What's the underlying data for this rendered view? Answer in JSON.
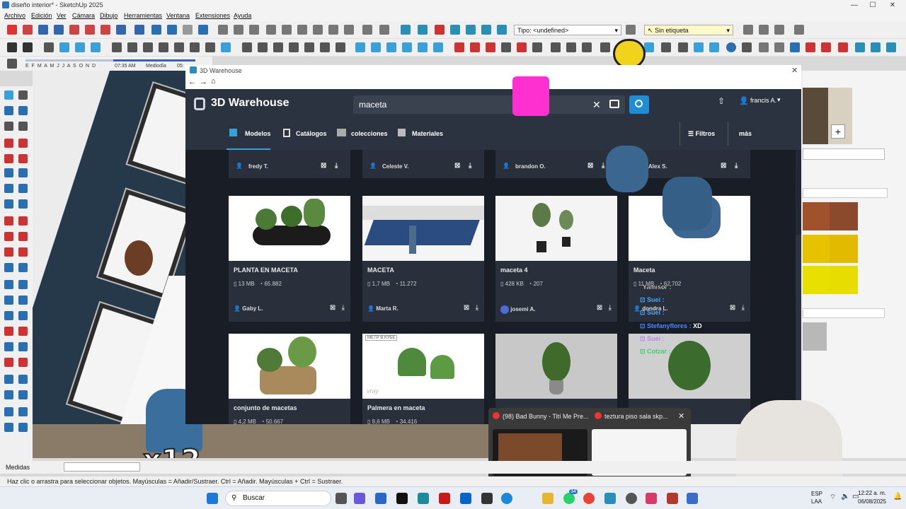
{
  "window": {
    "title": "diseño interior* - SketchUp 2025"
  },
  "menu": [
    "Archivo",
    "Edición",
    "Ver",
    "Cámara",
    "Dibujo",
    "Herramientas",
    "Ventana",
    "Extensiones",
    "Ayuda"
  ],
  "toolbar": {
    "type_dropdown": "Tipo: <undefined>",
    "tag_dropdown": "Sin etiqueta"
  },
  "sun": {
    "months": "E F M A M J J A S O N D",
    "time_start": "07:35 AM",
    "midday": "Mediodía",
    "time_end": "05:"
  },
  "warehouse": {
    "window_title": "3D Warehouse",
    "logo": "3D Warehouse",
    "search_value": "maceta",
    "user": "francis A.",
    "tabs": [
      "Modelos",
      "Catálogos",
      "colecciones",
      "Materiales"
    ],
    "filters": "Filtros",
    "more": "más",
    "top_users": [
      "fredy T.",
      "Celeste V.",
      "brandon O.",
      "Alex S."
    ],
    "row1": [
      {
        "name": "PLANTA EN MACETA",
        "size": "13 MB",
        "views": "65.882",
        "user": "Gaby L."
      },
      {
        "name": "MACETA",
        "size": "1,7 MB",
        "views": "11.272",
        "user": "Marta R."
      },
      {
        "name": "maceta 4",
        "size": "428 KB",
        "views": "207",
        "user": "josemi A."
      },
      {
        "name": "Maceta",
        "size": "11 MB",
        "views": "62.702",
        "user": "dondra L."
      }
    ],
    "row2": [
      {
        "name": "conjunto de macetas",
        "size": "4,2 MB",
        "views": "50.667"
      },
      {
        "name": "Palmera en maceta",
        "size": "8,6 MB",
        "views": "34.416"
      },
      {
        "name": "",
        "size": "",
        "views": ""
      },
      {
        "name": "",
        "size": "",
        "views": ""
      }
    ],
    "thumb_badge": "МЕТР В КУБЕ",
    "thumb_watermark": "vray"
  },
  "chat": [
    {
      "user": "Yamisor",
      "msg": ""
    },
    {
      "user": "Suei",
      "msg": ""
    },
    {
      "user": "Suei",
      "msg": ""
    },
    {
      "user": "Stefanyflores",
      "msg": "XD"
    },
    {
      "user": "Suei",
      "msg": ""
    },
    {
      "user": "Cotzar",
      "msg": ""
    }
  ],
  "overlay_multiplier": "x12",
  "popup": {
    "tab1": "(98) Bad Bunny - Tití Me Pre...",
    "tab2": "teztura piso sala skp..."
  },
  "measures_label": "Medidas",
  "status_text": "Haz clic o arrastra para seleccionar objetos. Mayúsculas = Añadir/Sustraer. Ctrl = Añadir. Mayúsculas + Ctrl = Sustraer.",
  "taskbar": {
    "search": "Buscar",
    "lang": "ESP",
    "lang2": "LAA",
    "time": "12:22 a. m.",
    "date": "06/08/2025",
    "badge": "34"
  },
  "colors": {
    "accent": "#1f8dd6",
    "warehouse_bg": "#222833",
    "wall": "#25394b"
  }
}
